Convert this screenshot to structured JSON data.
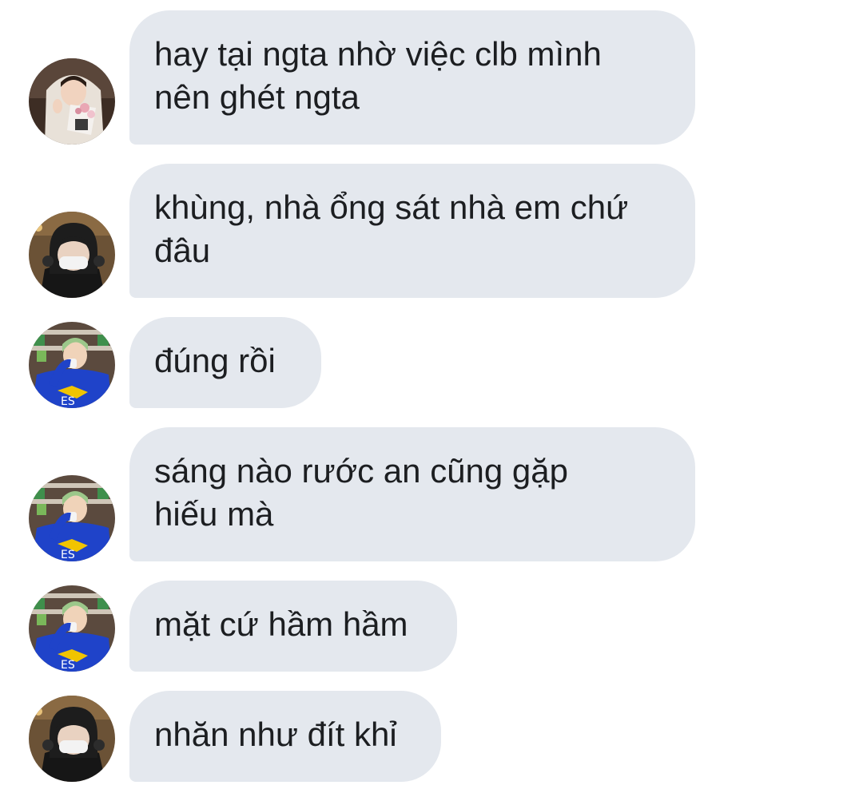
{
  "conversation": {
    "messages": [
      {
        "avatar": "person-hoodie-flowers-avatar",
        "lines": [
          "hay tại ngta nhờ việc clb mình",
          "nên ghét ngta"
        ]
      },
      {
        "avatar": "person-black-cap-mask-avatar",
        "lines": [
          "khùng, nhà ổng sát nhà em chứ",
          "đâu"
        ]
      },
      {
        "avatar": "person-blue-jacket-avatar",
        "lines": [
          "đúng rồi"
        ]
      },
      {
        "avatar": "person-blue-jacket-avatar",
        "lines": [
          "sáng nào rước an cũng gặp",
          "hiếu mà"
        ]
      },
      {
        "avatar": "person-blue-jacket-avatar",
        "lines": [
          "mặt cứ hầm hầm"
        ]
      },
      {
        "avatar": "person-black-cap-mask-avatar",
        "lines": [
          "nhăn như đít khỉ"
        ]
      }
    ]
  },
  "colors": {
    "bubble": "#e4e8ee",
    "text": "#1c1e21",
    "background": "#ffffff"
  }
}
